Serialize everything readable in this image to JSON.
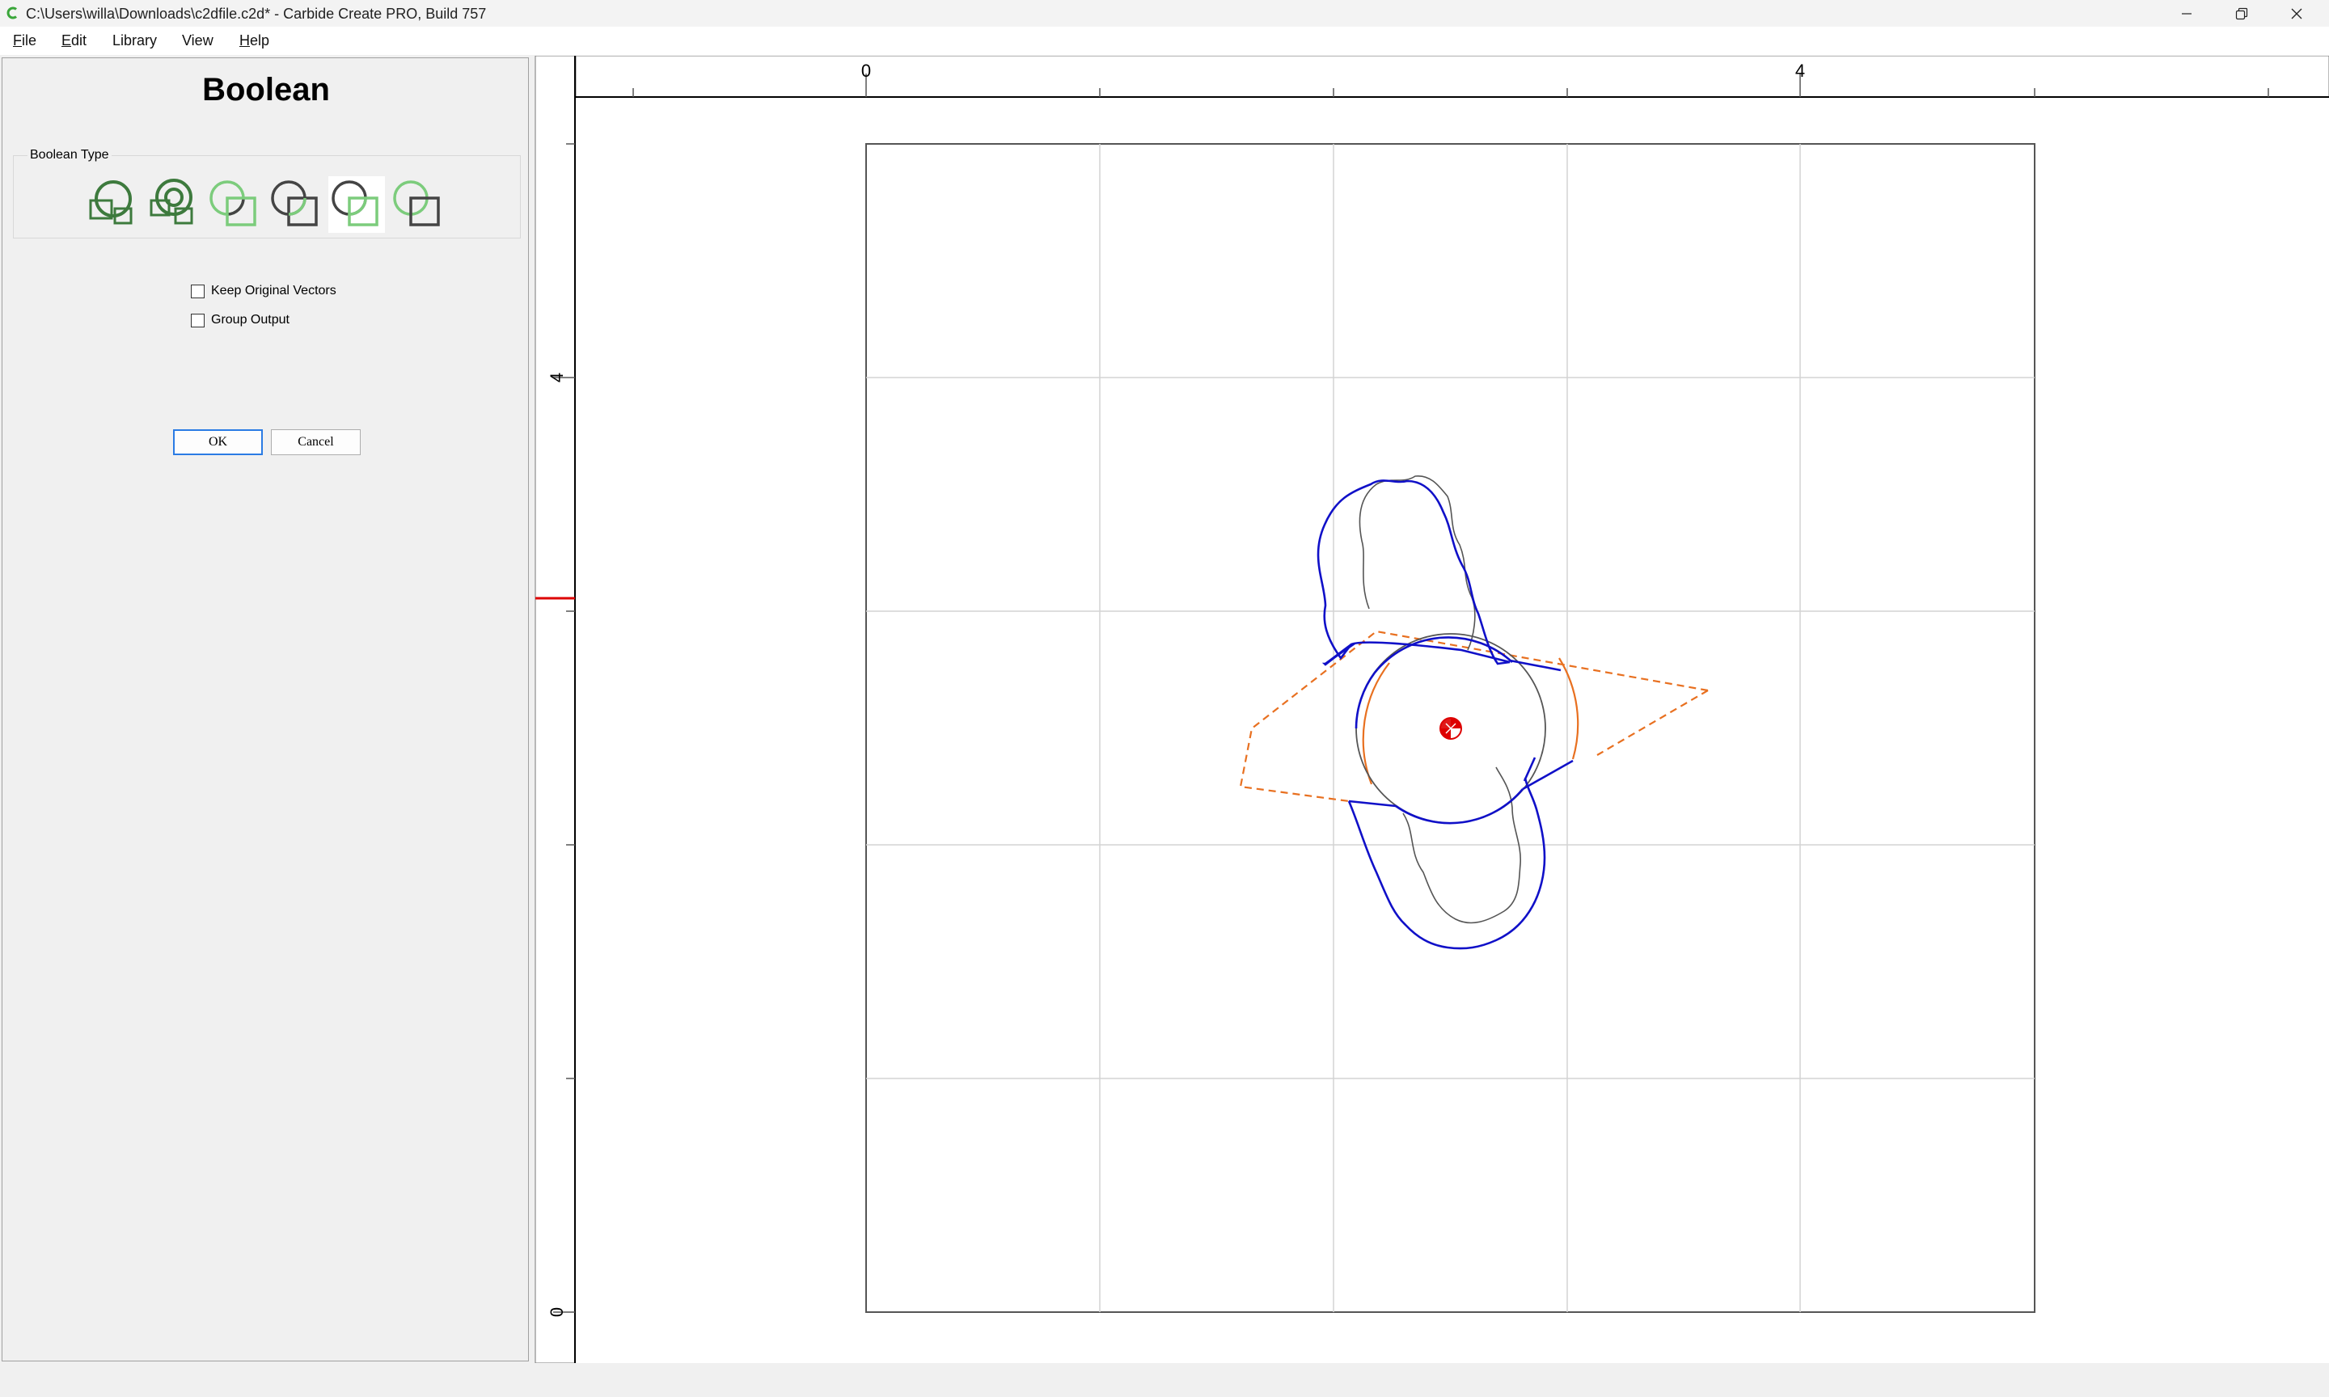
{
  "window": {
    "title": "C:\\Users\\willa\\Downloads\\c2dfile.c2d* - Carbide Create PRO, Build 757",
    "icon": "carbide-create-logo",
    "controls": [
      "minimize-icon",
      "restore-icon",
      "close-icon"
    ]
  },
  "menu": {
    "file": {
      "u": "F",
      "rest": "ile"
    },
    "edit": {
      "u": "E",
      "rest": "dit"
    },
    "library": {
      "u": "",
      "rest": "Library"
    },
    "view": {
      "u": "",
      "rest": "View"
    },
    "help": {
      "u": "H",
      "rest": "elp"
    }
  },
  "panel": {
    "title": "Boolean",
    "boolean_type_label": "Boolean Type",
    "boolean_types": [
      "union-icon",
      "combine-icon",
      "subtract-icon",
      "subtract-reverse-icon",
      "intersect-icon",
      "exclude-icon"
    ],
    "keep_original_label": "Keep Original Vectors",
    "keep_original_checked": false,
    "group_output_label": "Group Output",
    "group_output_checked": false,
    "ok_label": "OK",
    "cancel_label": "Cancel"
  },
  "canvas": {
    "ruler_top": {
      "label_0": "0",
      "label_4": "4"
    },
    "ruler_left": {
      "label_4": "4",
      "label_0": "0"
    },
    "colors": {
      "selected": "#1010c8",
      "toolpath_dashed": "#e87020",
      "origin_marker": "#dd0000",
      "grid": "#d4d4d4",
      "vector": "#555555"
    }
  }
}
